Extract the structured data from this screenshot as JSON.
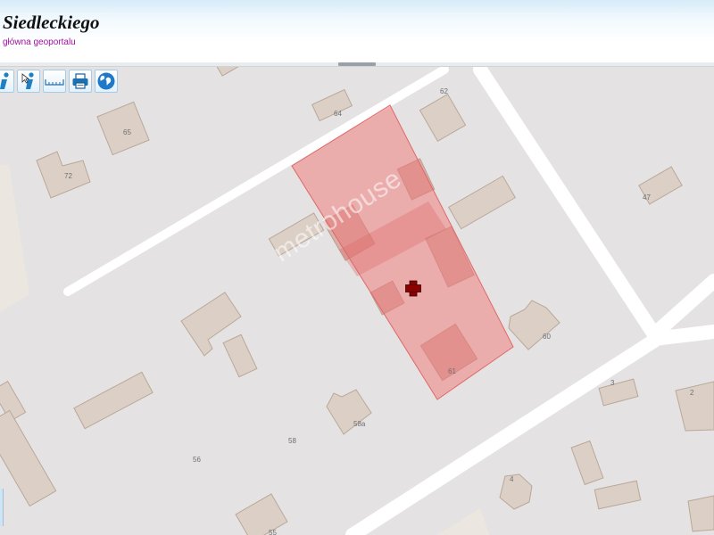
{
  "header": {
    "title": "Siedleckiego",
    "subtitle": "główna geoportalu"
  },
  "toolbar": {
    "buttons": [
      {
        "icon": "info-icon"
      },
      {
        "icon": "info-pointer-icon"
      },
      {
        "icon": "ruler-icon"
      },
      {
        "icon": "printer-icon"
      },
      {
        "icon": "globe-icon"
      }
    ]
  },
  "map": {
    "watermark": "metrohouse",
    "parcel_color": "#f08080",
    "marker_color": "#8b0000",
    "house_numbers": {
      "n62": "62",
      "n64": "64",
      "n65": "65",
      "n72": "72",
      "n47": "47",
      "n60": "60",
      "n61": "61",
      "n3": "3",
      "n2": "2",
      "n58a": "58a",
      "n58": "58",
      "n56": "56",
      "n4": "4",
      "n55": "55"
    }
  }
}
